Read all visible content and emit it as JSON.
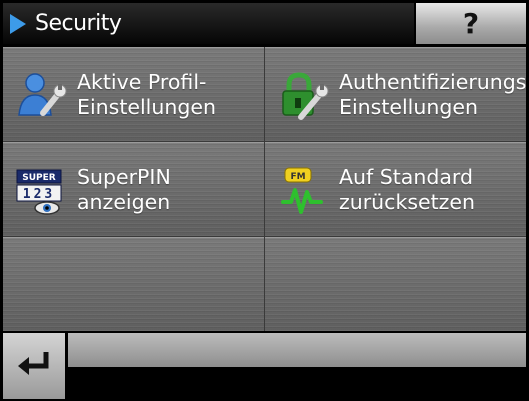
{
  "header": {
    "title": "Security",
    "help_label": "?"
  },
  "tiles": [
    {
      "label": "Aktive Profil-\nEinstellungen",
      "icon": "user-wrench-icon"
    },
    {
      "label": "Authentifizierungs\nEinstellungen",
      "icon": "lock-wrench-icon"
    },
    {
      "label": "SuperPIN\nanzeigen",
      "icon": "superpin-icon",
      "icon_text": "SUPER",
      "icon_digits": "123"
    },
    {
      "label": "Auf Standard\nzurücksetzen",
      "icon": "factory-reset-icon",
      "icon_text": "FM"
    }
  ],
  "colors": {
    "accent_blue": "#3d9be9",
    "tile_gray": "#6b6b6b"
  }
}
